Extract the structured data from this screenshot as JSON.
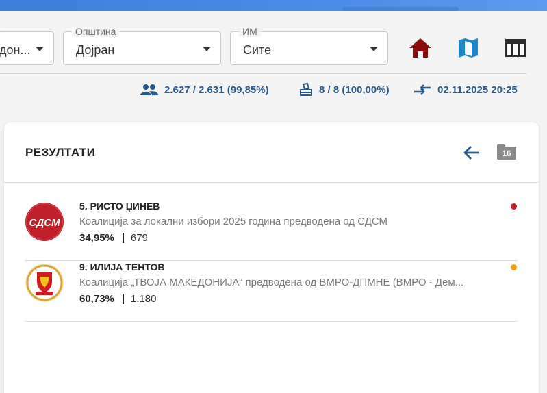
{
  "filters": {
    "region": {
      "value": "дон..."
    },
    "municipality": {
      "label": "Општина",
      "value": "Дојран"
    },
    "im": {
      "label": "ИМ",
      "value": "Сите"
    }
  },
  "toolbar": {
    "home_icon": "home-icon",
    "map_icon": "map-icon",
    "table_icon": "table-icon"
  },
  "stats": {
    "voters": "2.627 / 2.631 (99,85%)",
    "stations": "8 / 8 (100,00%)",
    "updated": "02.11.2025 20:25"
  },
  "results": {
    "title": "РЕЗУЛТАТИ",
    "count": "16",
    "items": [
      {
        "name": "5. РИСТО ЏИНЕВ",
        "coalition": "Коалиција за локални избори 2025 година предводена од СДСМ",
        "percent": "34,95%",
        "votes": "679",
        "logo_text": "СДСМ",
        "color": "#c0202a"
      },
      {
        "name": "9. ИЛИЈА ТЕНТОВ",
        "coalition": "Коалиција „ТВОЈА МАКЕДОНИЈА“ предводена од ВМРО-ДПМНЕ (ВМРО - Дем...",
        "percent": "60,73%",
        "votes": "1.180",
        "color": "#f0a01c"
      }
    ]
  },
  "colors": {
    "accent": "#285a8a",
    "home": "#8b0a0a",
    "map": "#1e86c8",
    "topbar": "#4a8de6"
  }
}
